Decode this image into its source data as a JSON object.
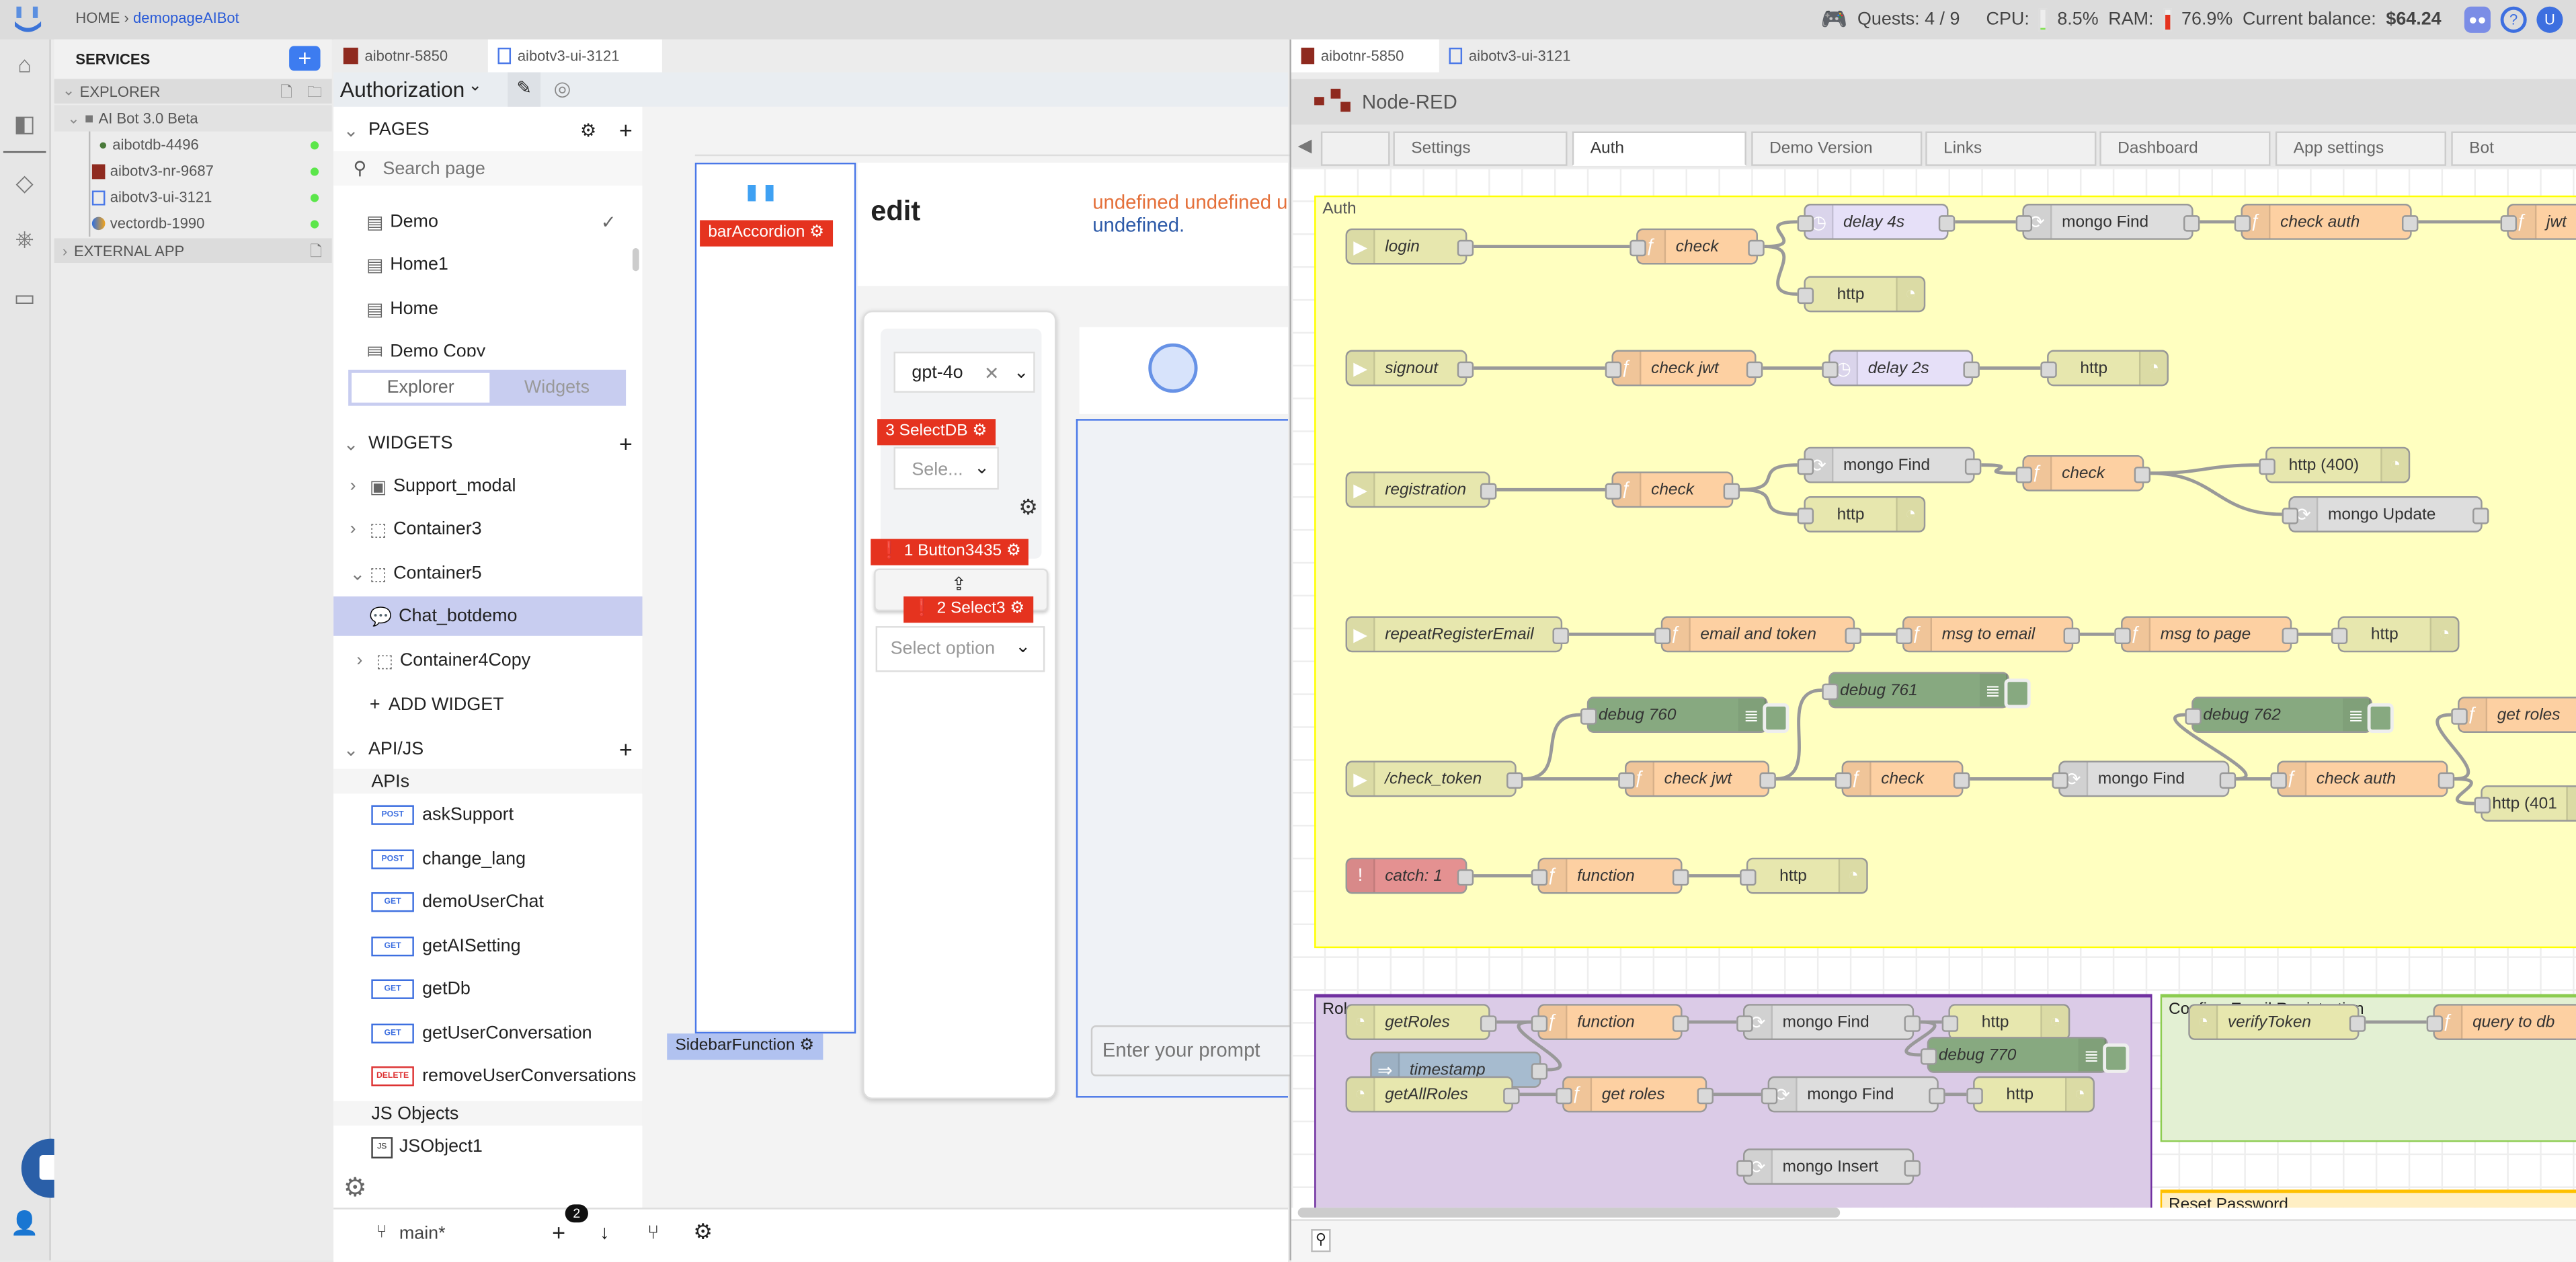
{
  "topbar": {
    "breadcrumb_home": "HOME",
    "breadcrumb_sep": "›",
    "breadcrumb_current": "demopageAIBot",
    "quests_label": "Quests: 4 / 9",
    "cpu_label": "CPU:",
    "cpu_value": "8.5%",
    "cpu_percent": 8.5,
    "ram_label": "RAM:",
    "ram_value": "76.9%",
    "ram_percent": 76.9,
    "balance_label": "Current balance:",
    "balance_value": "$64.24",
    "help_label": "?",
    "avatar_letter": "U"
  },
  "services": {
    "title": "SERVICES",
    "add_label": "+",
    "explorer_label": "EXPLORER",
    "project_label": "AI Bot 3.0 Beta",
    "items": [
      {
        "name": "aibotdb-4496",
        "status": "online"
      },
      {
        "name": "aibotv3-nr-9687",
        "status": "online"
      },
      {
        "name": "aibotv3-ui-3121",
        "status": "online"
      },
      {
        "name": "vectordb-1990",
        "status": "online"
      }
    ],
    "external_label": "EXTERNAL APP"
  },
  "app": {
    "tabs": [
      {
        "label": "aibotnr-5850"
      },
      {
        "label": "aibotv3-ui-3121"
      }
    ],
    "page_selector": "Authorization",
    "pages_title": "PAGES",
    "search_placeholder": "Search page",
    "pages": [
      {
        "label": "Demo",
        "checked": true
      },
      {
        "label": "Home1"
      },
      {
        "label": "Home"
      },
      {
        "label": "Demo Copy"
      }
    ],
    "toggle": {
      "explorer": "Explorer",
      "widgets": "Widgets"
    },
    "widgets_title": "WIDGETS",
    "widgets": [
      {
        "label": "Support_modal",
        "caret": "›"
      },
      {
        "label": "Container3",
        "caret": "›"
      },
      {
        "label": "Container5",
        "caret": "⌄"
      },
      {
        "label": "Chat_botdemo",
        "selected": true
      },
      {
        "label": "Container4Copy",
        "caret": "›"
      }
    ],
    "add_widget": "ADD WIDGET",
    "apijs_title": "API/JS",
    "apis_label": "APIs",
    "apis": [
      {
        "method": "POST",
        "name": "askSupport"
      },
      {
        "method": "POST",
        "name": "change_lang"
      },
      {
        "method": "GET",
        "name": "demoUserChat"
      },
      {
        "method": "GET",
        "name": "getAISetting"
      },
      {
        "method": "GET",
        "name": "getDb"
      },
      {
        "method": "GET",
        "name": "getUserConversation"
      },
      {
        "method": "DELETE",
        "name": "removeUserConversations"
      }
    ],
    "jsobjects_label": "JS Objects",
    "jsobjects": [
      {
        "badge": "JS",
        "name": "JSObject1"
      }
    ],
    "footer": {
      "branch": "main*",
      "pending_count": "2"
    }
  },
  "canvas": {
    "title": "edit",
    "undefined_line1": "undefined undefined u",
    "undefined_line2": "undefined.",
    "tags": {
      "accordion": "barAccordion",
      "selectdb": "3  SelectDB",
      "button": "1  Button3435",
      "select3": "2  Select3",
      "sidebar_function": "SidebarFunction"
    },
    "model_select": "gpt-4o",
    "db_select_placeholder": "Sele...",
    "option_placeholder": "Select option",
    "prompt_placeholder": "Enter your prompt"
  },
  "nodered": {
    "tabs": [
      {
        "label": "aibotnr-5850"
      },
      {
        "label": "aibotv3-ui-3121"
      }
    ],
    "title": "Node-RED",
    "flow_tabs": [
      "",
      "Settings",
      "Auth",
      "Demo Version",
      "Links",
      "Dashboard",
      "App settings",
      "Bot"
    ],
    "active_flow": "Auth",
    "groups": {
      "auth": "Auth",
      "roles": "Roles",
      "confirm": "Confirm Email Registration",
      "reset": "Reset Password"
    },
    "nodes": {
      "login": "login",
      "check1": "check",
      "delay4": "delay 4s",
      "mongofind1": "mongo Find",
      "checkauth1": "check auth",
      "jwt": "jwt",
      "http1": "http",
      "signout": "signout",
      "checkjwt1": "check jwt",
      "delay2": "delay 2s",
      "http2": "http",
      "registration": "registration",
      "check2": "check",
      "mongofind2": "mongo Find",
      "http3": "http",
      "check3": "check",
      "http400": "http (400)",
      "mongoupdate": "mongo Update",
      "repeat": "repeatRegisterEmail",
      "emailtoken": "email and token",
      "msgemail": "msg to email",
      "msgpage": "msg to page",
      "http4": "http",
      "checktoken": "/check_token",
      "checkjwt2": "check jwt",
      "check4": "check",
      "mongofind3": "mongo Find",
      "checkauth2": "check auth",
      "getroles1": "get roles",
      "http401": "http (401",
      "debug760": "debug 760",
      "debug761": "debug 761",
      "debug762": "debug 762",
      "catch": "catch: 1",
      "function1": "function",
      "http5": "http",
      "getRoles": "getRoles",
      "function2": "function",
      "mongofind4": "mongo Find",
      "http6": "http",
      "debug770": "debug 770",
      "timestamp": "timestamp",
      "getAllRoles": "getAllRoles",
      "getroles2": "get roles",
      "mongofind5": "mongo Find",
      "http7": "http",
      "mongoinsert": "mongo Insert",
      "verifyToken": "verifyToken",
      "querydb": "query to db"
    }
  }
}
